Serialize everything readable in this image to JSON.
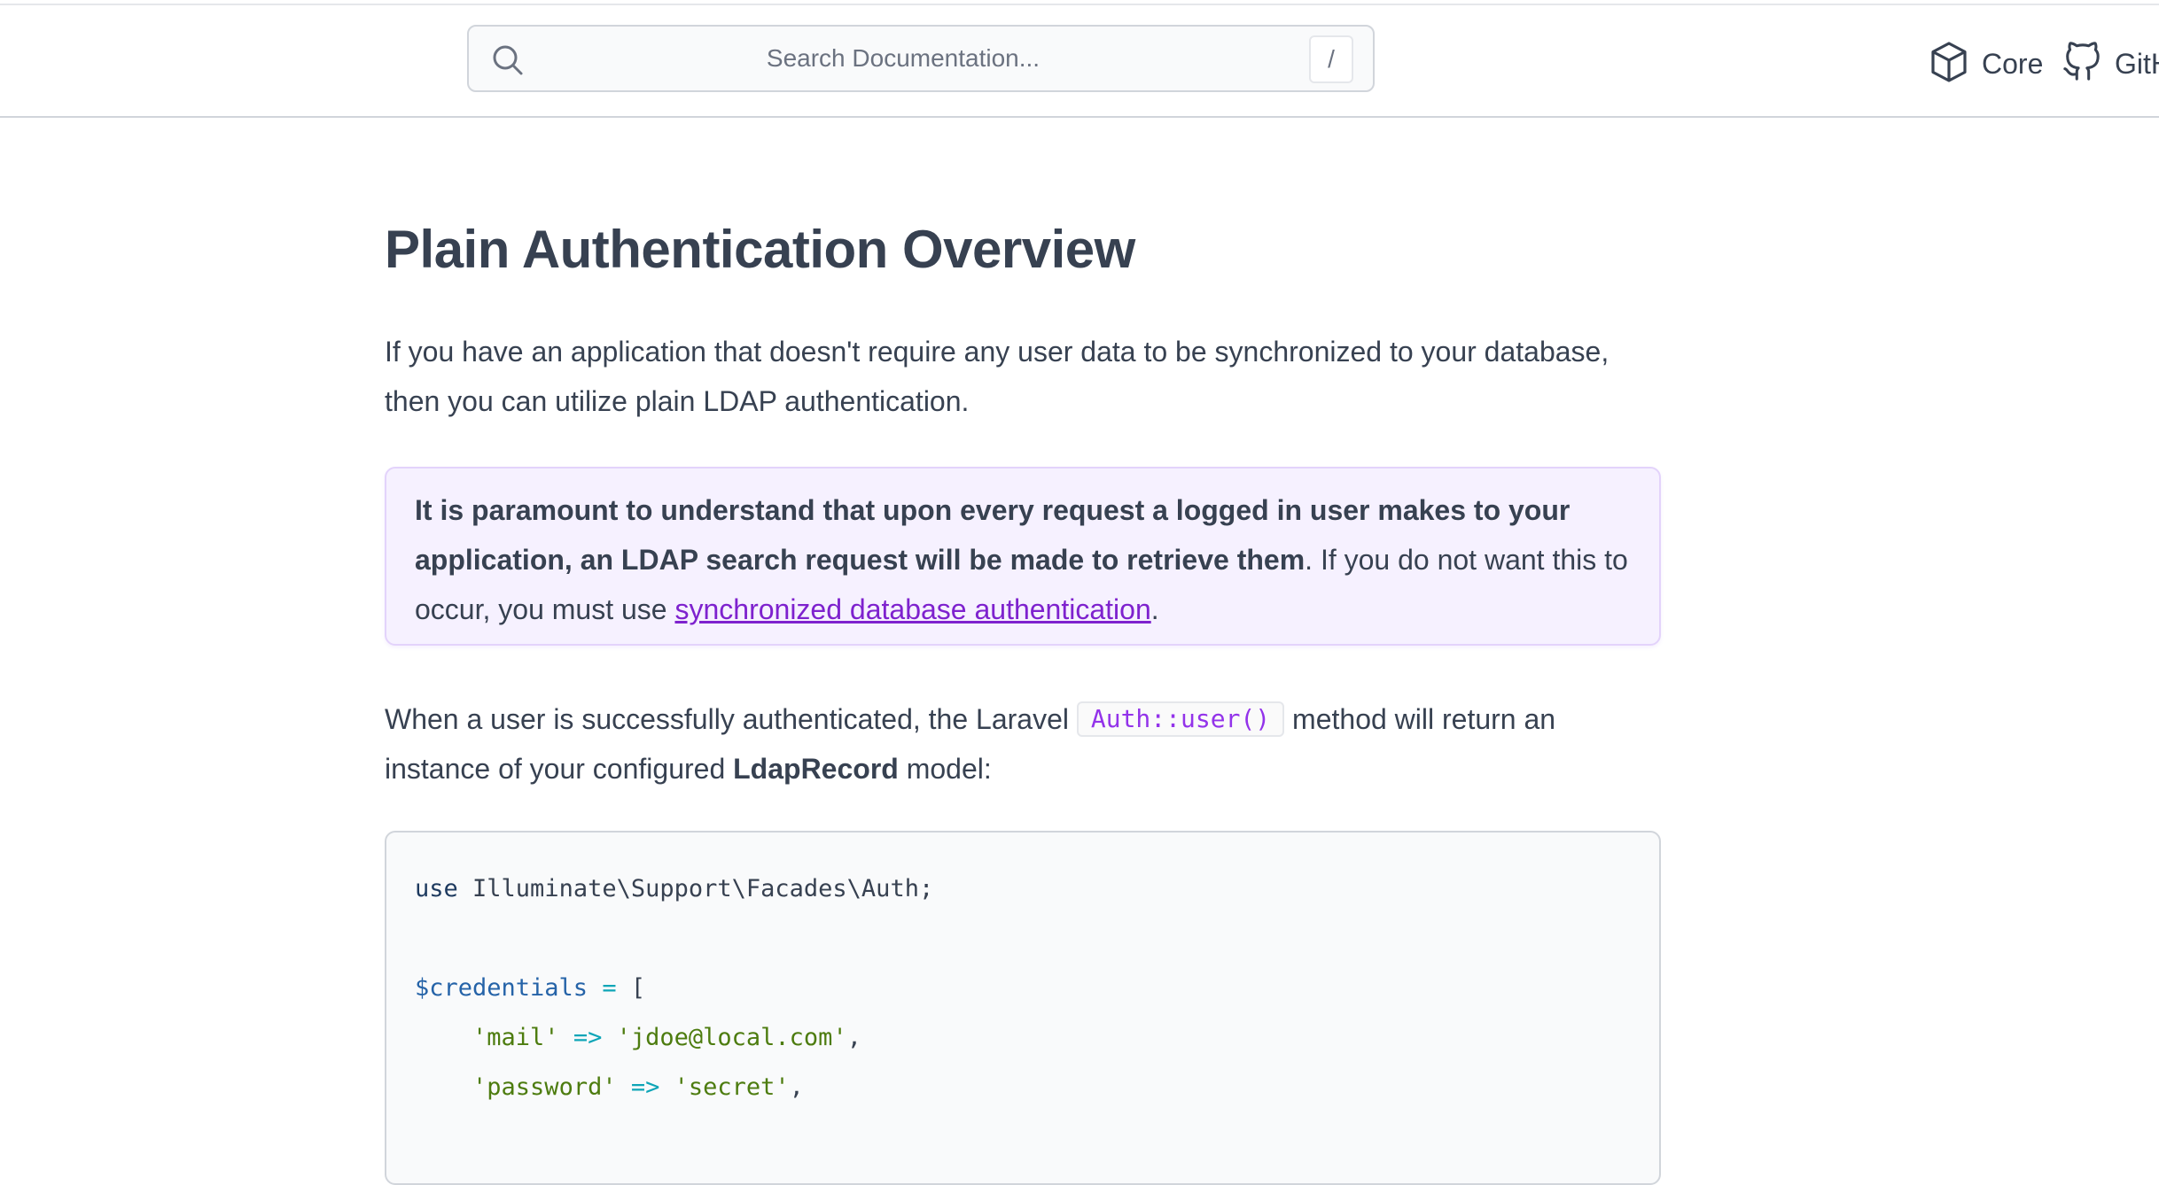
{
  "header": {
    "search_placeholder": "Search Documentation...",
    "search_shortcut": "/",
    "nav": [
      {
        "label": "Core",
        "icon": "cube-icon"
      },
      {
        "label": "GitHub",
        "icon": "github-icon"
      }
    ]
  },
  "article": {
    "title": "Plain Authentication Overview",
    "intro": "If you have an application that doesn't require any user data to be synchronized to your database, then you can utilize plain LDAP authentication.",
    "callout": {
      "bold": "It is paramount to understand that upon every request a logged in user makes to your application, an LDAP search request will be made to retrieve them",
      "text": ". If you do not want this to occur, you must use ",
      "link": "synchronized database authentication",
      "end": "."
    },
    "para2": {
      "before": "When a user is successfully authenticated, the Laravel ",
      "code": "Auth::user()",
      "middle": " method will return an instance of your configured ",
      "bold": "LdapRecord",
      "end": " model:"
    },
    "code": {
      "line1_kw": "use",
      "line1_rest": " Illuminate\\Support\\Facades\\Auth;",
      "line3_var": "$credentials",
      "line3_op": " = ",
      "line3_bracket": "[",
      "line4_key": "'mail'",
      "line4_op": " => ",
      "line4_val": "'jdoe@local.com'",
      "line4_comma": ",",
      "line5_key": "'password'",
      "line5_op": " => ",
      "line5_val": "'secret'",
      "line5_comma": ","
    }
  },
  "colors": {
    "accent": "#7e22ce",
    "callout_bg": "#f6f1ff",
    "text": "#374151"
  }
}
